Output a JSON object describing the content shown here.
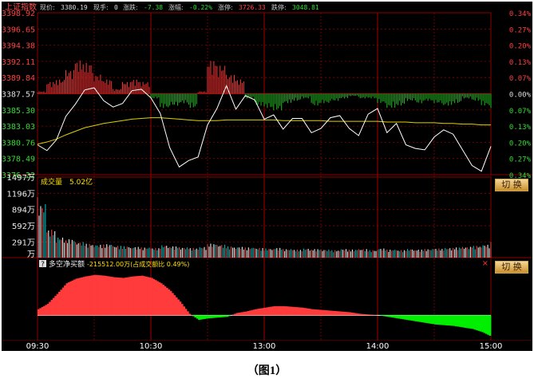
{
  "header": {
    "index_name": "上证指数",
    "fields": [
      {
        "label": "现价:",
        "value": "3380.19",
        "color": "#dddddd"
      },
      {
        "label": "现手:",
        "value": "0",
        "color": "#dddddd"
      },
      {
        "label": "涨跌:",
        "value": "-7.38",
        "color": "#33dd33"
      },
      {
        "label": "涨幅:",
        "value": "-0.22%",
        "color": "#33dd33"
      },
      {
        "label": "涨停:",
        "value": "3726.33",
        "color": "#ff4444"
      },
      {
        "label": "跌停:",
        "value": "3048.81",
        "color": "#33dd33"
      }
    ]
  },
  "volume_panel": {
    "title": "成交量",
    "value": "5.02亿",
    "button_label": "切 换"
  },
  "flow_panel": {
    "badge": "?",
    "title": "多空净买额",
    "value": "-215512.00万(占成交额比 0.49%)",
    "button_label": "切 换",
    "close": "×"
  },
  "caption": {
    "left": "（图",
    "num": "1",
    "right": "）"
  },
  "colors": {
    "background": "#000000",
    "grid": "#8b0000",
    "up": "#ff3333",
    "down": "#22bb22",
    "price_line": "#ffffff",
    "avg_line": "#e0d000",
    "flow_pos": "#ff3b3b",
    "flow_neg": "#00ee00"
  },
  "chart_data": [
    {
      "type": "line",
      "title": "上证指数",
      "x_ticks": [
        "09:30",
        "10:30",
        "13:00",
        "14:00",
        "15:00"
      ],
      "y_left_ticks": [
        "3398.92",
        "3396.65",
        "3394.38",
        "3392.11",
        "3389.84",
        "3387.57",
        "3385.30",
        "3383.03",
        "3380.76",
        "3378.49",
        "3376.22"
      ],
      "y_right_ticks": [
        "0.34%",
        "0.27%",
        "0.20%",
        "0.13%",
        "0.07%",
        "0.00%",
        "0.07%",
        "0.13%",
        "0.20%",
        "0.27%",
        "0.34%"
      ],
      "ylim": [
        3376.22,
        3398.92
      ],
      "baseline": 3387.57,
      "x_minutes": [
        0,
        5,
        10,
        15,
        20,
        25,
        30,
        35,
        40,
        45,
        50,
        55,
        60,
        65,
        70,
        75,
        80,
        85,
        90,
        95,
        100,
        105,
        110,
        115,
        120,
        125,
        130,
        135,
        140,
        145,
        150,
        155,
        160,
        165,
        170,
        175,
        180,
        185,
        190,
        195,
        200,
        205,
        210,
        215,
        220,
        225,
        230,
        235,
        240
      ],
      "series": [
        {
          "name": "现价",
          "values": [
            3380.4,
            3379.6,
            3381.1,
            3384.4,
            3386.1,
            3388.1,
            3388.4,
            3386.6,
            3385.7,
            3386.2,
            3388.0,
            3388.2,
            3387.0,
            3384.8,
            3380.0,
            3377.3,
            3378.2,
            3378.7,
            3383.2,
            3385.5,
            3388.7,
            3385.4,
            3387.3,
            3386.7,
            3384.0,
            3384.6,
            3382.6,
            3384.1,
            3384.1,
            3382.1,
            3382.7,
            3384.2,
            3384.5,
            3382.7,
            3381.7,
            3384.7,
            3385.5,
            3382.1,
            3383.4,
            3380.4,
            3379.9,
            3379.7,
            3381.5,
            3382.5,
            3381.9,
            3379.7,
            3377.5,
            3376.7,
            3380.2
          ]
        },
        {
          "name": "均价",
          "values": [
            3380.5,
            3380.8,
            3381.2,
            3381.8,
            3382.3,
            3382.8,
            3383.1,
            3383.4,
            3383.6,
            3383.8,
            3384.0,
            3384.1,
            3384.2,
            3384.2,
            3384.1,
            3384.0,
            3383.9,
            3383.8,
            3383.8,
            3383.8,
            3383.9,
            3383.9,
            3383.9,
            3383.9,
            3383.9,
            3383.9,
            3383.8,
            3383.8,
            3383.8,
            3383.8,
            3383.8,
            3383.7,
            3383.7,
            3383.7,
            3383.7,
            3383.7,
            3383.7,
            3383.6,
            3383.6,
            3383.6,
            3383.5,
            3383.5,
            3383.5,
            3383.4,
            3383.4,
            3383.3,
            3383.3,
            3383.2,
            3383.2
          ]
        }
      ],
      "bars": {
        "note": "up/down strength bars around 0.00% line, value in % units",
        "values": [
          0.01,
          0.05,
          0.06,
          0.1,
          0.14,
          0.13,
          0.08,
          0.06,
          0.02,
          0.05,
          0.06,
          0.05,
          -0.02,
          -0.06,
          -0.05,
          -0.04,
          -0.06,
          0.01,
          0.14,
          0.12,
          0.08,
          0.06,
          -0.02,
          -0.05,
          -0.06,
          -0.07,
          -0.04,
          -0.03,
          -0.02,
          -0.05,
          -0.04,
          -0.03,
          -0.02,
          -0.01,
          -0.02,
          -0.02,
          -0.04,
          -0.06,
          -0.05,
          -0.03,
          -0.04,
          -0.03,
          -0.04,
          -0.05,
          -0.04,
          -0.02,
          -0.03,
          -0.05,
          -0.06
        ]
      }
    },
    {
      "type": "bar",
      "title": "成交量",
      "y_ticks": [
        "1497万",
        "1196万",
        "894万",
        "592万",
        "291万",
        "万"
      ],
      "ylim": [
        0,
        1497
      ],
      "x_minutes": [
        0,
        5,
        10,
        15,
        20,
        25,
        30,
        35,
        40,
        45,
        50,
        55,
        60,
        65,
        70,
        75,
        80,
        85,
        90,
        95,
        100,
        105,
        110,
        115,
        120,
        125,
        130,
        135,
        140,
        145,
        150,
        155,
        160,
        165,
        170,
        175,
        180,
        185,
        190,
        195,
        200,
        205,
        210,
        215,
        220,
        225,
        230,
        235,
        240
      ],
      "values": [
        1000,
        520,
        380,
        340,
        290,
        260,
        240,
        250,
        220,
        210,
        200,
        190,
        180,
        230,
        210,
        190,
        180,
        200,
        260,
        240,
        210,
        200,
        190,
        180,
        170,
        180,
        160,
        150,
        170,
        160,
        150,
        140,
        160,
        150,
        160,
        140,
        170,
        150,
        140,
        160,
        150,
        160,
        170,
        180,
        190,
        200,
        220,
        240,
        300
      ]
    },
    {
      "type": "area",
      "title": "多空净买额",
      "x_minutes": [
        0,
        5,
        10,
        15,
        20,
        25,
        30,
        35,
        40,
        45,
        50,
        55,
        60,
        65,
        70,
        75,
        80,
        85,
        90,
        95,
        100,
        105,
        110,
        115,
        120,
        125,
        130,
        135,
        140,
        145,
        150,
        155,
        160,
        165,
        170,
        175,
        180,
        185,
        190,
        195,
        200,
        205,
        210,
        215,
        220,
        225,
        230,
        235,
        240
      ],
      "values": [
        8,
        15,
        28,
        42,
        48,
        51,
        53,
        52,
        50,
        49,
        51,
        52,
        49,
        42,
        32,
        18,
        2,
        -6,
        -4,
        -3,
        -2,
        3,
        5,
        8,
        10,
        12,
        12,
        11,
        10,
        8,
        7,
        6,
        5,
        4,
        2,
        1,
        0,
        -2,
        -4,
        -6,
        -8,
        -10,
        -12,
        -13,
        -14,
        -16,
        -18,
        -22,
        -28
      ]
    }
  ]
}
